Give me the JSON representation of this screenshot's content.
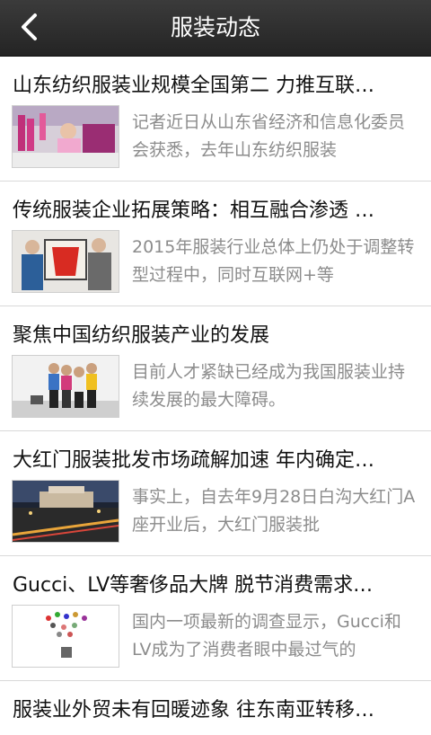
{
  "header": {
    "title": "服装动态",
    "back_icon": "chevron-left-icon"
  },
  "articles": [
    {
      "title": "山东纺织服装业规模全国第二 力推互联…",
      "summary": "记者近日从山东省经济和信息化委员会获悉，去年山东纺织服装"
    },
    {
      "title": "传统服装企业拓展策略：相互融合渗透 …",
      "summary": "2015年服装行业总体上仍处于调整转型过程中，同时互联网+等"
    },
    {
      "title": "聚焦中国纺织服装产业的发展",
      "summary": "目前人才紧缺已经成为我国服装业持续发展的最大障碍。"
    },
    {
      "title": "大红门服装批发市场疏解加速 年内确定…",
      "summary": "事实上，自去年9月28日白沟大红门A座开业后，大红门服装批"
    },
    {
      "title": "Gucci、LV等奢侈品大牌 脱节消费需求…",
      "summary": "国内一项最新的调查显示，Gucci和LV成为了消费者眼中最过气的"
    },
    {
      "title": "服装业外贸未有回暖迹象 往东南亚转移…"
    }
  ]
}
